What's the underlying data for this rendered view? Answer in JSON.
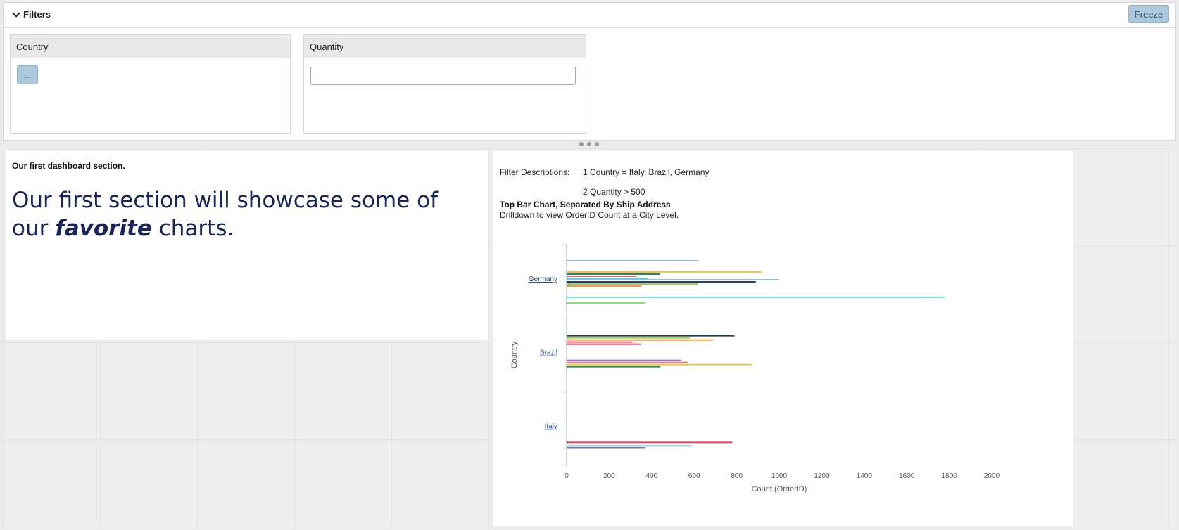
{
  "filters": {
    "toggle_label": "Filters",
    "freeze_label": "Freeze",
    "country": {
      "label": "Country",
      "button_label": "..."
    },
    "quantity": {
      "label": "Quantity",
      "value": ""
    }
  },
  "section_left": {
    "title": "Our first dashboard section.",
    "heading_before": "Our first section will showcase some of our",
    "heading_emph": "favorite",
    "heading_after": " charts."
  },
  "section_chart": {
    "filter_descriptions_label": "Filter Descriptions:",
    "filter_1": "1 Country = Italy, Brazil, Germany",
    "filter_2": "2 Quantity > 500",
    "title": "Top Bar Chart, Separated By Ship Address",
    "subtitle": "Drilldown to view OrderID Count at a City Level."
  },
  "chart_data": {
    "type": "bar",
    "orientation": "horizontal",
    "xlabel": "Count (OrderID)",
    "ylabel": "Country",
    "xlim": [
      0,
      2000
    ],
    "xticks": [
      "0",
      "200",
      "400",
      "600",
      "800",
      "1000",
      "1200",
      "1400",
      "1600",
      "1800",
      "2000"
    ],
    "categories": [
      "Germany",
      "Brazil",
      "Italy"
    ],
    "series_values": {
      "Germany": [
        620,
        920,
        440,
        330,
        380,
        1000,
        890,
        620,
        350,
        1780,
        370
      ],
      "Brazil": [
        790,
        580,
        690,
        310,
        350,
        540,
        570,
        870,
        440
      ],
      "Italy": [
        780,
        590,
        370
      ]
    },
    "series_colors": {
      "Germany": [
        "#8fb6e8",
        "#e8c84a",
        "#2e8b57",
        "#e0607a",
        "#5ad6d6",
        "#8fb6e8",
        "#2f3e4e",
        "#8fd468",
        "#f0a040",
        "#7de8d8",
        "#8fe070"
      ],
      "Brazil": [
        "#2f3e4e",
        "#8fd468",
        "#f0a040",
        "#e0607a",
        "#e04060",
        "#9a70e0",
        "#f07070",
        "#e8c84a",
        "#2e8b57"
      ],
      "Italy": [
        "#e04060",
        "#8fb6e8",
        "#2f3e4e"
      ]
    },
    "grid": false,
    "legend": "none"
  }
}
